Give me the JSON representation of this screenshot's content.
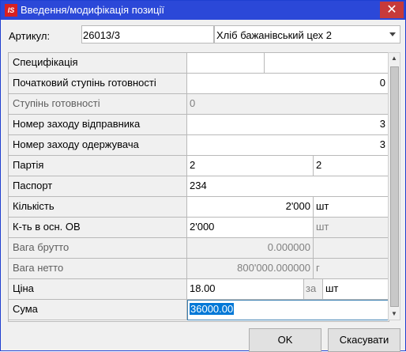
{
  "window": {
    "title": "Введення/модифікація позиції",
    "close_glyph": "✕",
    "app_icon_text": "IS"
  },
  "article": {
    "label": "Артикул:",
    "value": "26013/3",
    "shop": "Хліб бажанівський цех 2"
  },
  "grid": {
    "specification": {
      "label": "Специфікація",
      "v1": "",
      "v2": ""
    },
    "initial_readiness": {
      "label": "Початковий ступінь готовності",
      "value": "0"
    },
    "readiness": {
      "label": "Ступінь готовності",
      "value": "0"
    },
    "sender_number": {
      "label": "Номер заходу відправника",
      "value": "3"
    },
    "receiver_number": {
      "label": "Номер заходу одержувача",
      "value": "3"
    },
    "batch": {
      "label": "Партія",
      "v1": "2",
      "v2": "2"
    },
    "passport": {
      "label": "Паспорт",
      "value": "234"
    },
    "quantity": {
      "label": "Кількість",
      "value": "2'000",
      "unit": "шт"
    },
    "qty_base": {
      "label": "К-ть в осн. ОВ",
      "value": "2'000",
      "unit": "шт"
    },
    "gross_weight": {
      "label": "Вага брутто",
      "value": "0.000000",
      "unit": ""
    },
    "net_weight": {
      "label": "Вага нетто",
      "value": "800'000.000000",
      "unit": "г"
    },
    "price": {
      "label": "Ціна",
      "value": "18.00",
      "per": "за",
      "unit": "шт"
    },
    "sum": {
      "label": "Сума",
      "value": "36000.00"
    }
  },
  "buttons": {
    "ok": "OK",
    "cancel": "Скасувати"
  }
}
